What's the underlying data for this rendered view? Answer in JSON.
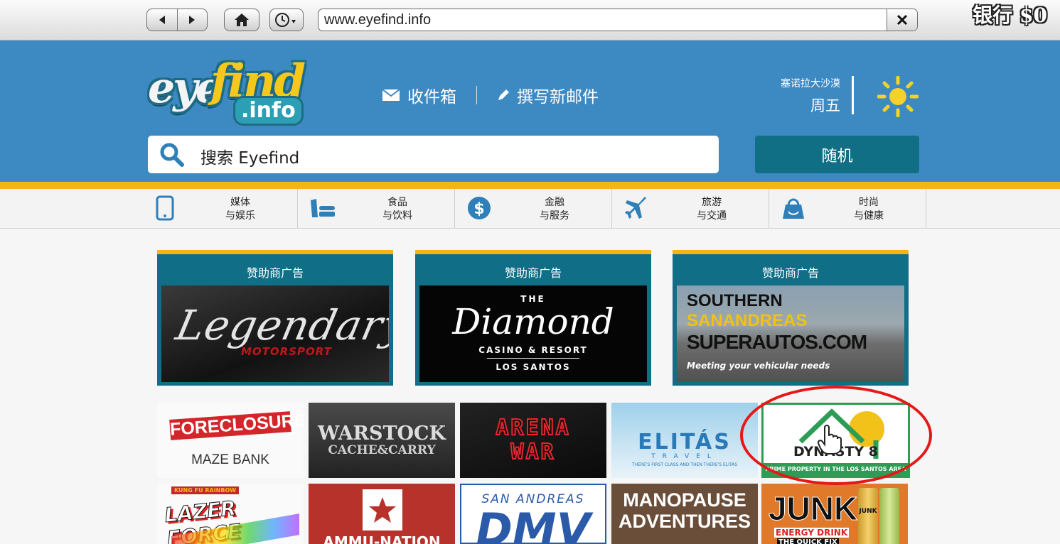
{
  "browser": {
    "url": "www.eyefind.info",
    "bank": "银行 $0"
  },
  "header": {
    "logo_eye": "eye",
    "logo_find": "find",
    "logo_info": ".info",
    "inbox": "收件箱",
    "compose": "撰写新邮件",
    "location": "塞诺拉大沙漠",
    "day": "周五",
    "search_placeholder": "搜索 Eyefind",
    "random": "随机"
  },
  "categories": [
    {
      "line1": "媒体",
      "line2": "与娱乐",
      "icon": "tablet-icon"
    },
    {
      "line1": "食品",
      "line2": "与饮料",
      "icon": "food-icon"
    },
    {
      "line1": "金融",
      "line2": "与服务",
      "icon": "dollar-icon"
    },
    {
      "line1": "旅游",
      "line2": "与交通",
      "icon": "plane-icon"
    },
    {
      "line1": "时尚",
      "line2": "与健康",
      "icon": "bag-icon"
    }
  ],
  "sponsors": [
    {
      "title": "赞助商广告",
      "main": "Legendary",
      "sub": "MOTORSPORT"
    },
    {
      "title": "赞助商广告",
      "top": "THE",
      "main": "Diamond",
      "sub": "CASINO & RESORT",
      "sub2": "LOS SANTOS"
    },
    {
      "title": "赞助商广告",
      "line1": "SOUTHERN",
      "line2": "SANANDREAS",
      "line3": "SUPERAUTOS.COM",
      "line4": "Meeting your vehicular needs"
    }
  ],
  "tiles": {
    "foreclosure": {
      "main": "FORECLOSURE",
      "sub": "MAZE BANK"
    },
    "warstock": {
      "line1": "WARSTOCK",
      "line2": "CACHE&CARRY"
    },
    "arena": {
      "line1": "ARENA",
      "line2": "WAR"
    },
    "elitas": {
      "main": "ELITÁS",
      "sub": "TRAVEL",
      "tag": "THERE'S FIRST CLASS AND THEN THERE'S ELITAS"
    },
    "dynasty": {
      "main": "DYNASTY 8",
      "sub": "PRIME PROPERTY IN THE LOS SANTOS AREA"
    },
    "lazer": {
      "top": "KUNG FU RAINBOW",
      "main": "LAZER FORCE"
    },
    "ammu": {
      "main": "AMMU-NATION"
    },
    "dmv": {
      "top": "SAN ANDREAS",
      "main": "DMV"
    },
    "manopause": {
      "line1": "MANOPAUSE",
      "line2": "ADVENTURES"
    },
    "junk": {
      "main": "JUNK",
      "sub": "ENERGY DRINK",
      "sub2": "THE QUICK FIX",
      "can": "JUNK"
    }
  }
}
